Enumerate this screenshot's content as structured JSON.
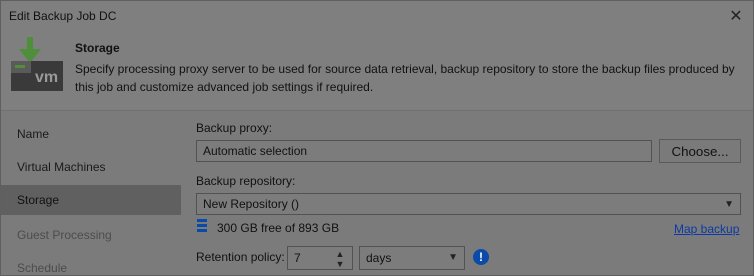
{
  "window": {
    "title": "Edit Backup Job DC"
  },
  "header": {
    "title": "Storage",
    "description": "Specify processing proxy server to be used for source data retrieval, backup repository to store the backup files produced by this job and customize advanced job settings if required.",
    "icon": "storage-vm-icon"
  },
  "sidebar": {
    "items": [
      {
        "label": "Name",
        "state": "normal"
      },
      {
        "label": "Virtual Machines",
        "state": "normal"
      },
      {
        "label": "Storage",
        "state": "active"
      },
      {
        "label": "Guest Processing",
        "state": "disabled"
      },
      {
        "label": "Schedule",
        "state": "disabled"
      }
    ]
  },
  "form": {
    "backup_proxy_label": "Backup proxy:",
    "backup_proxy_value": "Automatic selection",
    "choose_button": "Choose...",
    "backup_repository_label": "Backup repository:",
    "backup_repository_value": "New Repository ()",
    "free_space": "300 GB free of 893 GB",
    "map_backup_link": "Map backup",
    "retention_label": "Retention policy:",
    "retention_value": "7",
    "retention_unit": "days"
  },
  "colors": {
    "accent_blue": "#0a4aa8",
    "link_blue": "#0b3aa6",
    "active_sidebar": "#606060"
  }
}
